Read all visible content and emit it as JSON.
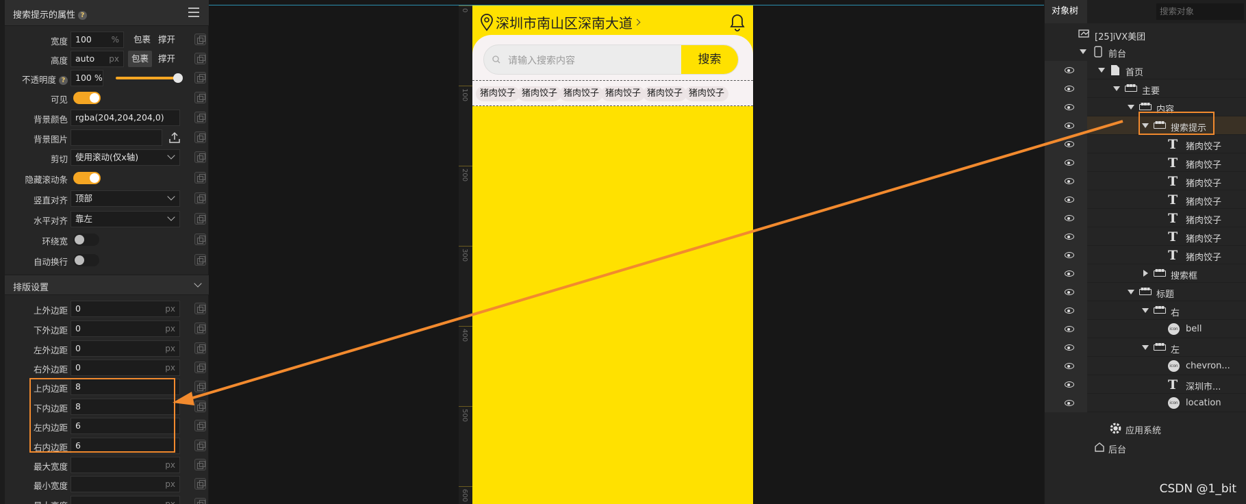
{
  "left_panel": {
    "title": "搜索提示的属性",
    "help": "?",
    "props": {
      "width": {
        "label": "宽度",
        "value": "100",
        "unit": "%",
        "opt1": "包裹",
        "opt2": "撑开"
      },
      "height": {
        "label": "高度",
        "value": "auto",
        "unit": "px",
        "opt1": "包裹",
        "opt2": "撑开"
      },
      "opacity": {
        "label": "不透明度",
        "value": "100 %"
      },
      "visible": {
        "label": "可见"
      },
      "bg_color": {
        "label": "背景颜色",
        "value": "rgba(204,204,204,0)"
      },
      "bg_image": {
        "label": "背景图片"
      },
      "clip": {
        "label": "剪切",
        "value": "使用滚动(仅x轴)"
      },
      "hide_scroll": {
        "label": "隐藏滚动条"
      },
      "valign": {
        "label": "竖直对齐",
        "value": "顶部"
      },
      "halign": {
        "label": "水平对齐",
        "value": "靠左"
      },
      "wrap_width": {
        "label": "环绕宽"
      },
      "auto_wrap": {
        "label": "自动换行"
      }
    },
    "section": "排版设置",
    "layout": {
      "margin_top": {
        "label": "上外边距",
        "value": "0",
        "unit": "px"
      },
      "margin_bottom": {
        "label": "下外边距",
        "value": "0",
        "unit": "px"
      },
      "margin_left": {
        "label": "左外边距",
        "value": "0",
        "unit": "px"
      },
      "margin_right": {
        "label": "右外边距",
        "value": "0",
        "unit": "px"
      },
      "padding_top": {
        "label": "上内边距",
        "value": "8"
      },
      "padding_bottom": {
        "label": "下内边距",
        "value": "8"
      },
      "padding_left": {
        "label": "左内边距",
        "value": "6"
      },
      "padding_right": {
        "label": "右内边距",
        "value": "6"
      },
      "max_width": {
        "label": "最大宽度",
        "unit": "px"
      },
      "min_width": {
        "label": "最小宽度",
        "unit": "px"
      },
      "max_height": {
        "label": "最大高度",
        "unit": "px"
      }
    }
  },
  "ruler_marks": [
    "0",
    "100",
    "200",
    "300",
    "400",
    "500",
    "600"
  ],
  "phone": {
    "address": "深圳市南山区深南大道",
    "search_placeholder": "请输入搜索内容",
    "search_button": "搜索",
    "tags": [
      "猪肉饺子",
      "猪肉饺子",
      "猪肉饺子",
      "猪肉饺子",
      "猪肉饺子",
      "猪肉饺子"
    ]
  },
  "right_panel": {
    "tab": "对象树",
    "search_placeholder": "搜索对象",
    "nodes": {
      "project": "[25]iVX美团",
      "frontend": "前台",
      "home": "首页",
      "main": "主要",
      "content": "内容",
      "search_hint": "搜索提示",
      "text": "猪肉饺子",
      "search_box": "搜索框",
      "header": "标题",
      "right": "右",
      "bell": "bell",
      "left": "左",
      "chevron": "chevron...",
      "city": "深圳市...",
      "location": "location",
      "app_system": "应用系统",
      "backend": "后台",
      "icon_badge": "icon"
    }
  },
  "watermark": "CSDN @1_bit",
  "colors": {
    "accent": "#f5a623",
    "highlight": "#f28a2e",
    "phone_bg": "#ffe100"
  }
}
